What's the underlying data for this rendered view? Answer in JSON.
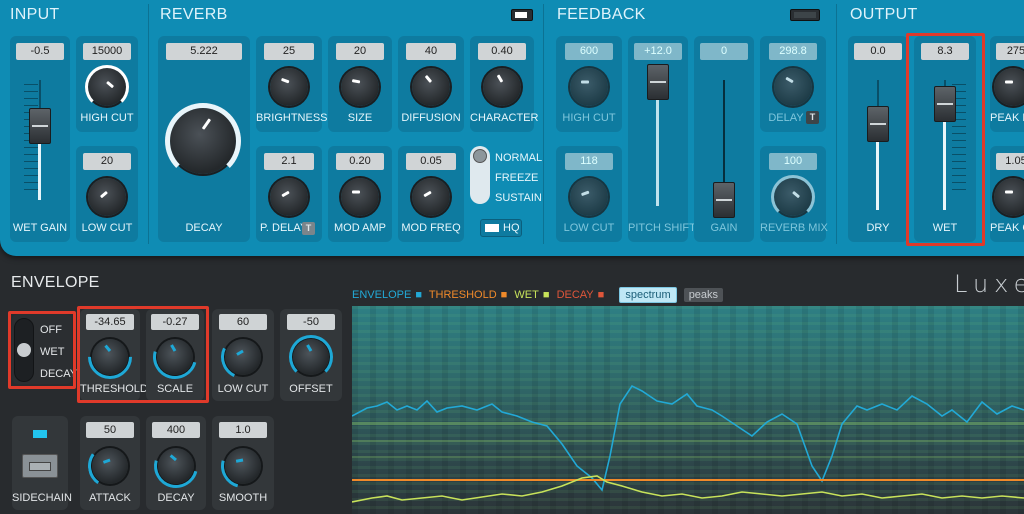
{
  "input": {
    "title": "INPUT",
    "wet_gain_value": "-0.5",
    "wet_gain_label": "WET GAIN",
    "high_cut_value": "15000",
    "high_cut_label": "HIGH CUT",
    "low_cut_value": "20",
    "low_cut_label": "LOW CUT"
  },
  "reverb": {
    "title": "REVERB",
    "decay_value": "5.222",
    "decay_label": "DECAY",
    "brightness_value": "25",
    "brightness_label": "BRIGHTNESS",
    "size_value": "20",
    "size_label": "SIZE",
    "diffusion_value": "40",
    "diffusion_label": "DIFFUSION",
    "character_value": "0.40",
    "character_label": "CHARACTER",
    "pdelay_value": "2.1",
    "pdelay_label": "P. DELAY",
    "modamp_value": "0.20",
    "modamp_label": "MOD AMP",
    "modfreq_value": "0.05",
    "modfreq_label": "MOD FREQ",
    "mode_options": [
      "NORMAL",
      "FREEZE",
      "SUSTAIN"
    ],
    "hq_label": "HQ",
    "t_badge": "T"
  },
  "feedback": {
    "title": "FEEDBACK",
    "high_cut_value": "600",
    "high_cut_label": "HIGH CUT",
    "pitch_value": "+12.0",
    "pitch_label": "PITCH SHIFT",
    "gain_value": "0",
    "gain_label": "GAIN",
    "delay_value": "298.8",
    "delay_label": "DELAY",
    "low_cut_value": "118",
    "low_cut_label": "LOW CUT",
    "reverb_mix_value": "100",
    "reverb_mix_label": "REVERB MIX",
    "t_badge": "T"
  },
  "output": {
    "title": "OUTPUT",
    "dry_value": "0.0",
    "dry_label": "DRY",
    "wet_value": "8.3",
    "wet_label": "WET",
    "peak_fr_value": "275",
    "peak_fr_label": "PEAK FR",
    "peak_c_value": "1.05",
    "peak_c_label": "PEAK C"
  },
  "envelope": {
    "title": "ENVELOPE",
    "mode_options": [
      "OFF",
      "WET",
      "DECAY"
    ],
    "threshold_value": "-34.65",
    "threshold_label": "THRESHOLD",
    "scale_value": "-0.27",
    "scale_label": "SCALE",
    "lowcut_value": "60",
    "lowcut_label": "LOW CUT",
    "offset_value": "-50",
    "offset_label": "OFFSET",
    "sidechain_label": "SIDECHAIN",
    "attack_value": "50",
    "attack_label": "ATTACK",
    "decay_value": "400",
    "decay_label": "DECAY",
    "smooth_value": "1.0",
    "smooth_label": "SMOOTH"
  },
  "display": {
    "legend": [
      {
        "text": "ENVELOPE",
        "color": "#22a9d6"
      },
      {
        "text": "THRESHOLD",
        "color": "#f08a2a"
      },
      {
        "text": "WET",
        "color": "#c7e25a"
      },
      {
        "text": "DECAY",
        "color": "#e0563a"
      }
    ],
    "spectrum_label": "spectrum",
    "peaks_label": "peaks",
    "brand": "Luxe"
  },
  "colors": {
    "accent": "#0f8cb4",
    "envelope": "#22a9d6",
    "threshold": "#f08a2a",
    "wet": "#c7e25a",
    "highlight": "#e03a2a"
  }
}
